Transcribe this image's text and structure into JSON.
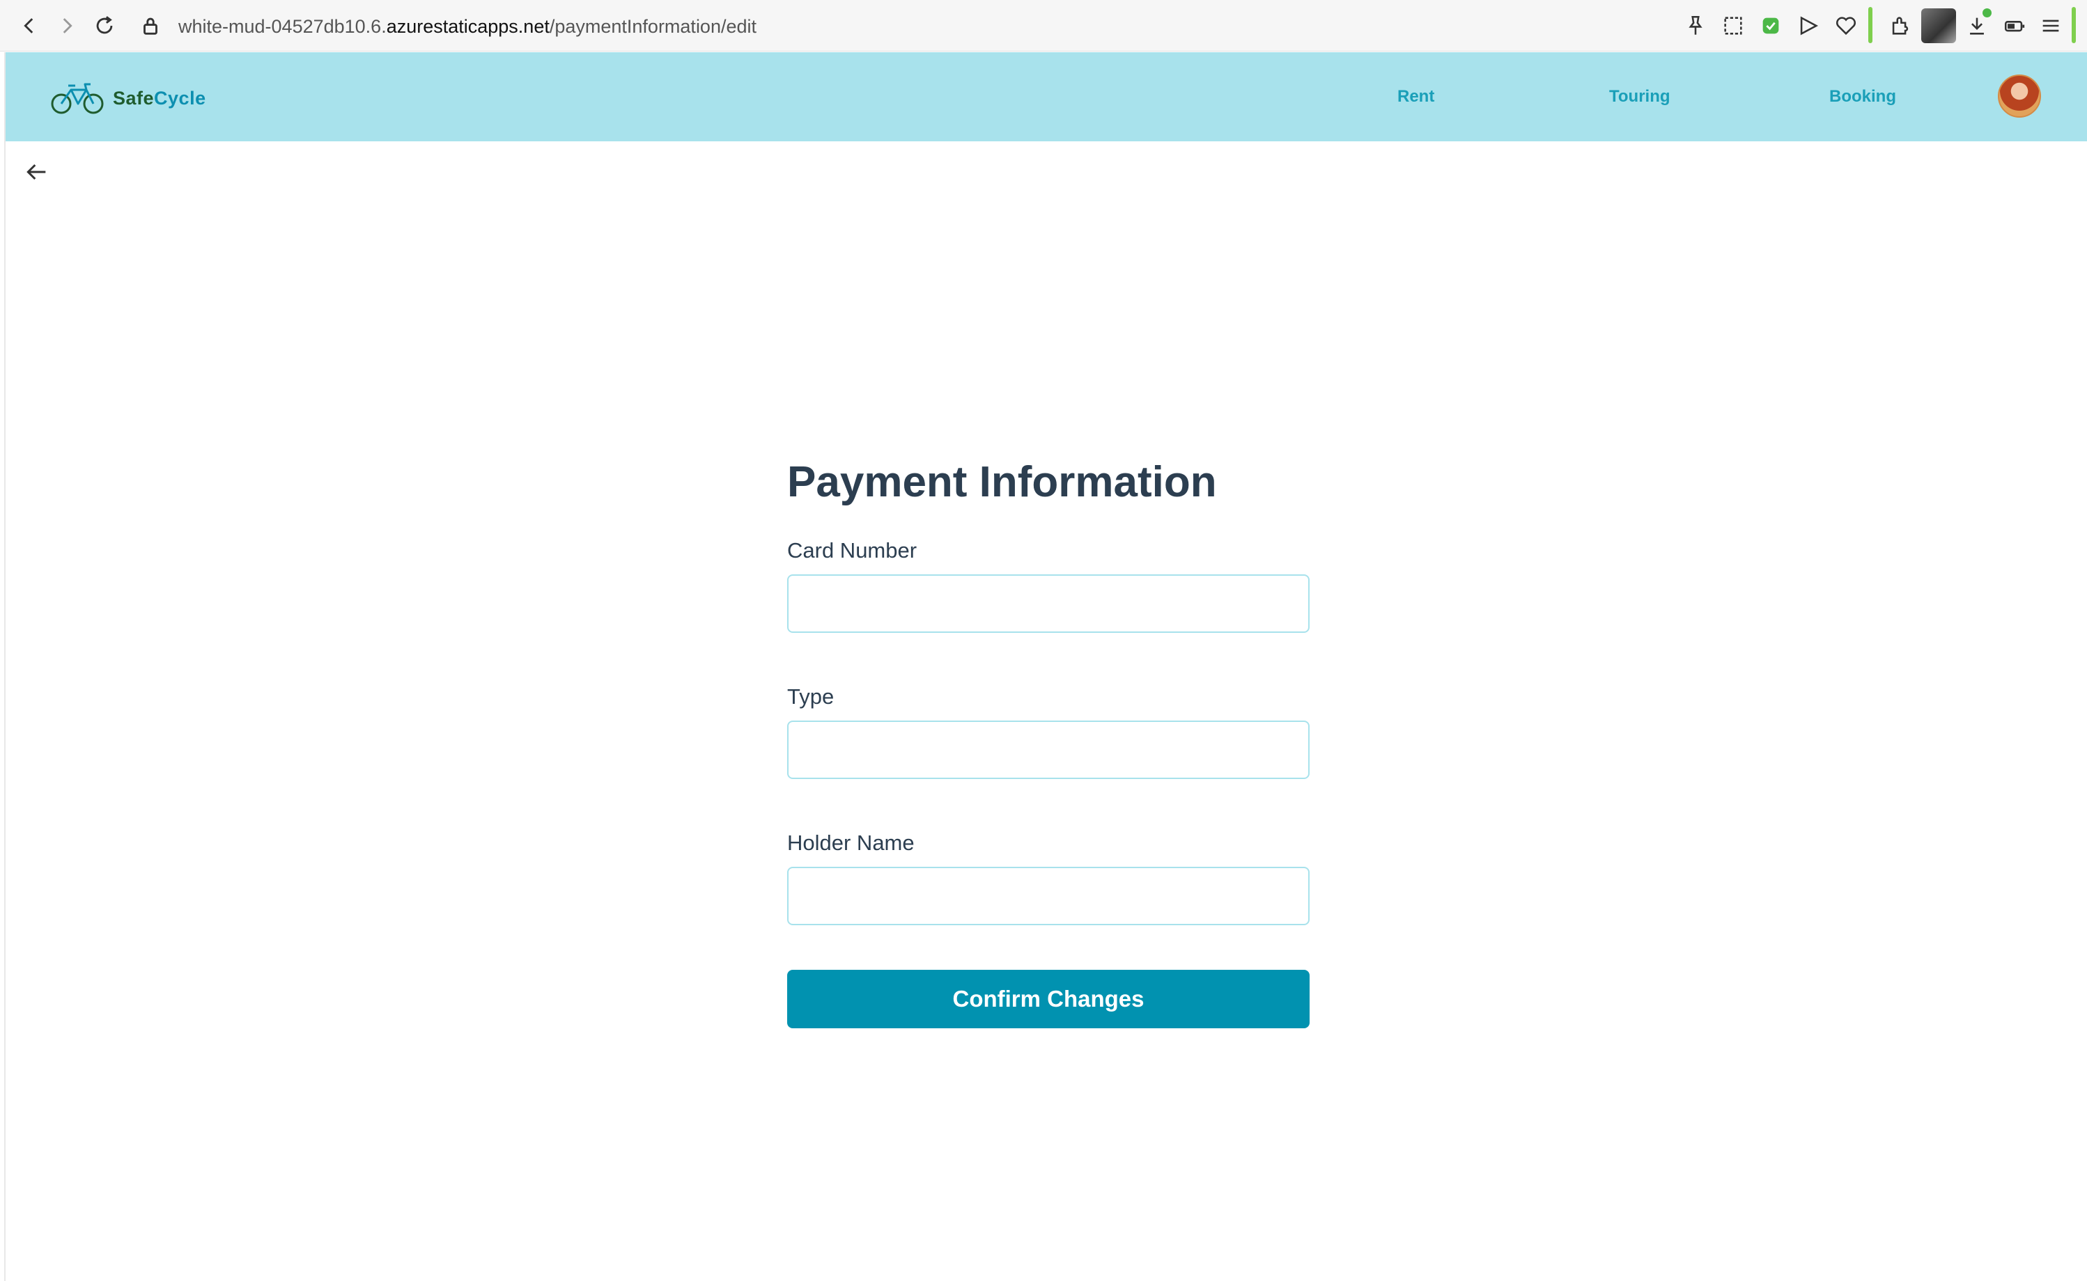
{
  "browser": {
    "url_prefix": "white-mud-04527db10.6.",
    "url_host": "azurestaticapps.net",
    "url_path": "/paymentInformation/edit"
  },
  "header": {
    "logo_text_a": "Safe",
    "logo_text_b": "Cycle",
    "nav": [
      {
        "label": "Rent"
      },
      {
        "label": "Touring"
      },
      {
        "label": "Booking"
      }
    ]
  },
  "form": {
    "title": "Payment Information",
    "fields": [
      {
        "label": "Card Number",
        "value": ""
      },
      {
        "label": "Type",
        "value": ""
      },
      {
        "label": "Holder Name",
        "value": ""
      }
    ],
    "submit_label": "Confirm Changes"
  },
  "colors": {
    "header_bg": "#a8e2ec",
    "nav_link": "#1a9fb8",
    "primary_button": "#0192b0",
    "input_border": "#a8e2ec",
    "title_text": "#2c3e50"
  },
  "icons": {
    "back": "arrow-left-icon",
    "logo": "bicycle-icon"
  }
}
